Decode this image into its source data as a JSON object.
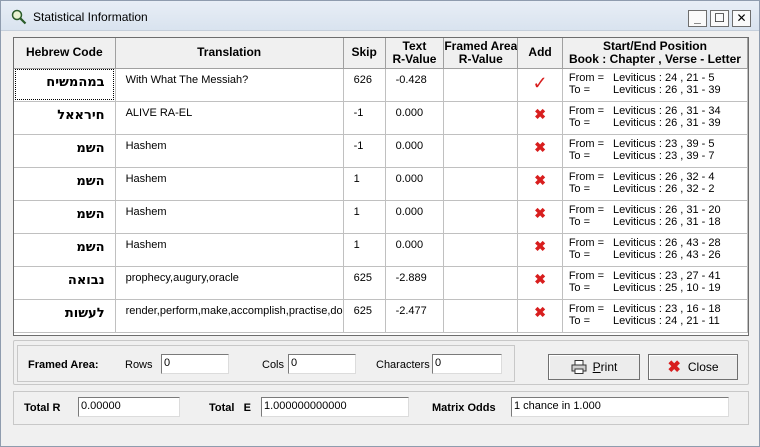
{
  "window": {
    "title": "Statistical Information",
    "minimize": "_",
    "maximize": "☐",
    "close": "✕"
  },
  "table": {
    "columns": {
      "hebrew": "Hebrew Code",
      "translation": "Translation",
      "skip": "Skip",
      "text_r_1": "Text",
      "text_r_2": "R-Value",
      "framed_1": "Framed Area",
      "framed_2": "R-Value",
      "add": "Add",
      "pos_1": "Start/End Position",
      "pos_2": "Book : Chapter , Verse - Letter"
    },
    "rows": [
      {
        "hebrew": "במהמשיח",
        "translation": "With What The Messiah?",
        "skip": "626",
        "text_r": "-0.428",
        "framed_r": "",
        "add": "check",
        "from_label": "From =",
        "from": "Leviticus : 24 , 21 - 5",
        "to_label": "To =",
        "to": "Leviticus : 26 , 31 - 39"
      },
      {
        "hebrew": "חיראאל",
        "translation": "ALIVE RA-EL",
        "skip": "-1",
        "text_r": "0.000",
        "framed_r": "",
        "add": "x",
        "from_label": "From =",
        "from": "Leviticus : 26 , 31 - 34",
        "to_label": "To =",
        "to": "Leviticus : 26 , 31 - 39"
      },
      {
        "hebrew": "השמ",
        "translation": "Hashem",
        "skip": "-1",
        "text_r": "0.000",
        "framed_r": "",
        "add": "x",
        "from_label": "From =",
        "from": "Leviticus : 23 , 39 - 5",
        "to_label": "To =",
        "to": "Leviticus : 23 , 39 - 7"
      },
      {
        "hebrew": "השמ",
        "translation": "Hashem",
        "skip": "1",
        "text_r": "0.000",
        "framed_r": "",
        "add": "x",
        "from_label": "From =",
        "from": "Leviticus : 26 , 32 - 4",
        "to_label": "To =",
        "to": "Leviticus : 26 , 32 - 2"
      },
      {
        "hebrew": "השמ",
        "translation": "Hashem",
        "skip": "1",
        "text_r": "0.000",
        "framed_r": "",
        "add": "x",
        "from_label": "From =",
        "from": "Leviticus : 26 , 31 - 20",
        "to_label": "To =",
        "to": "Leviticus : 26 , 31 - 18"
      },
      {
        "hebrew": "השמ",
        "translation": "Hashem",
        "skip": "1",
        "text_r": "0.000",
        "framed_r": "",
        "add": "x",
        "from_label": "From =",
        "from": "Leviticus : 26 , 43 - 28",
        "to_label": "To =",
        "to": "Leviticus : 26 , 43 - 26"
      },
      {
        "hebrew": "נבואה",
        "translation": "prophecy,augury,oracle",
        "skip": "625",
        "text_r": "-2.889",
        "framed_r": "",
        "add": "x",
        "from_label": "From =",
        "from": "Leviticus : 23 , 27 - 41",
        "to_label": "To =",
        "to": "Leviticus : 25 , 10 - 19"
      },
      {
        "hebrew": "לעשות",
        "translation": "render,perform,make,accomplish,practise,do",
        "skip": "625",
        "text_r": "-2.477",
        "framed_r": "",
        "add": "x",
        "from_label": "From =",
        "from": "Leviticus : 23 , 16 - 18",
        "to_label": "To =",
        "to": "Leviticus : 24 , 21 - 11"
      }
    ]
  },
  "framed": {
    "title": "Framed Area:",
    "rows_label": "Rows",
    "rows_value": "0",
    "cols_label": "Cols",
    "cols_value": "0",
    "chars_label": "Characters",
    "chars_value": "0"
  },
  "buttons": {
    "print_prefix": "",
    "print_ul": "P",
    "print_rest": "rint",
    "close": "Close"
  },
  "totals": {
    "total_r_label": "Total R",
    "total_r_value": "0.00000",
    "total_e_label": "Total   E",
    "total_e_value": "1.000000000000",
    "odds_label": "Matrix Odds",
    "odds_value": "1 chance in 1.000"
  },
  "icons": {
    "app": "magnifier-icon",
    "check": "checkmark-icon",
    "x": "x-mark-icon",
    "print": "printer-icon",
    "close": "close-x-icon"
  },
  "colors": {
    "accent_red": "#d81e1e",
    "title_bar": "#dde6f1"
  }
}
